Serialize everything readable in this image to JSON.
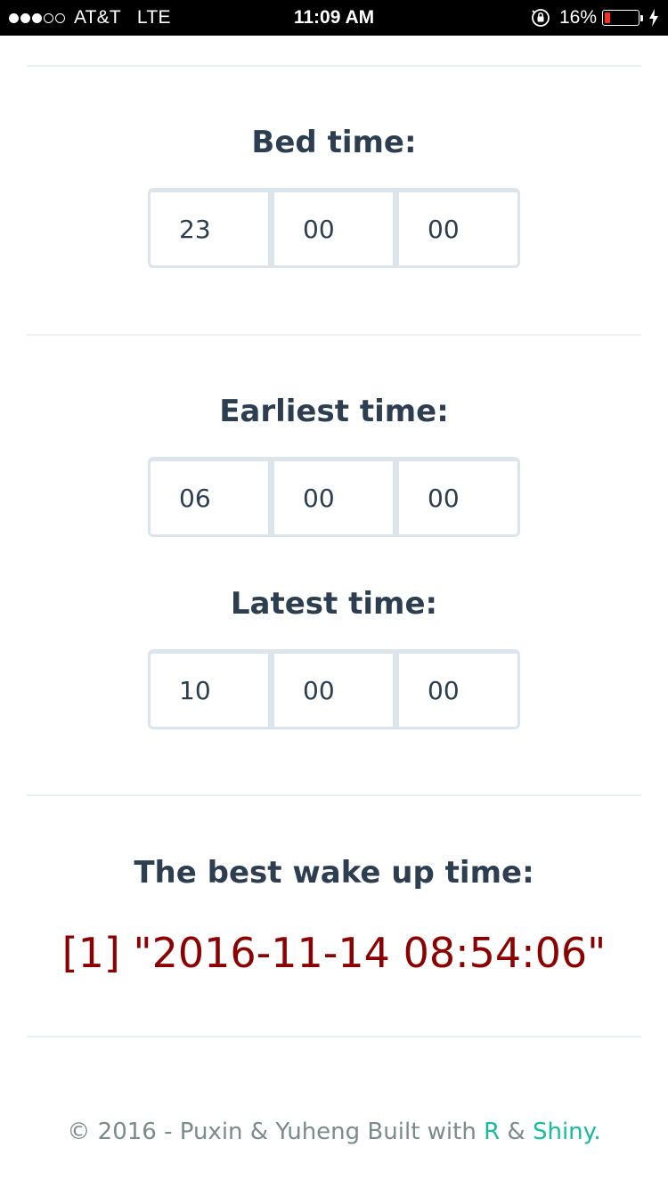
{
  "status_bar": {
    "signal_dots": [
      true,
      true,
      true,
      false,
      false
    ],
    "carrier": "AT&T",
    "network": "LTE",
    "time": "11:09 AM",
    "battery_percent": "16%",
    "battery_level": 0.16,
    "battery_color": "#ff2d20",
    "icons": [
      "orientation-lock-icon",
      "battery-icon",
      "charging-bolt-icon"
    ]
  },
  "bed_time": {
    "label": "Bed time:",
    "hour": "23",
    "minute": "00",
    "second": "00"
  },
  "earliest_time": {
    "label": "Earliest time:",
    "hour": "06",
    "minute": "00",
    "second": "00"
  },
  "latest_time": {
    "label": "Latest time:",
    "hour": "10",
    "minute": "00",
    "second": "00"
  },
  "result": {
    "label": "The best wake up time:",
    "value": "[1] \"2016-11-14 08:54:06\"",
    "color": "#8b0000"
  },
  "footer": {
    "text": "© 2016 - Puxin & Yuheng Built with ",
    "link_r": "R",
    "amp": " & ",
    "link_shiny": "Shiny.",
    "link_color": "#18bc9c"
  }
}
